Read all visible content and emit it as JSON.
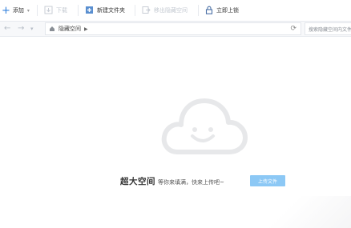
{
  "toolbar": {
    "add_label": "添加",
    "download_label": "下载",
    "new_folder_label": "新建文件夹",
    "move_out_label": "移出隐藏空间",
    "lock_label": "立即上锁"
  },
  "nav": {
    "back": "←",
    "forward": "→",
    "dropdown": "▾",
    "path": "隐藏空间",
    "refresh": "⟳"
  },
  "search": {
    "placeholder": "搜索隐藏空间内文件"
  },
  "empty_state": {
    "title": "超大空间",
    "subtitle": "等你来填满，快来上传吧~",
    "upload_button": "上传文件"
  },
  "colors": {
    "accent": "#2f7fdc",
    "upload_button": "#8cc8f5",
    "cloud": "#e7e8ea"
  }
}
